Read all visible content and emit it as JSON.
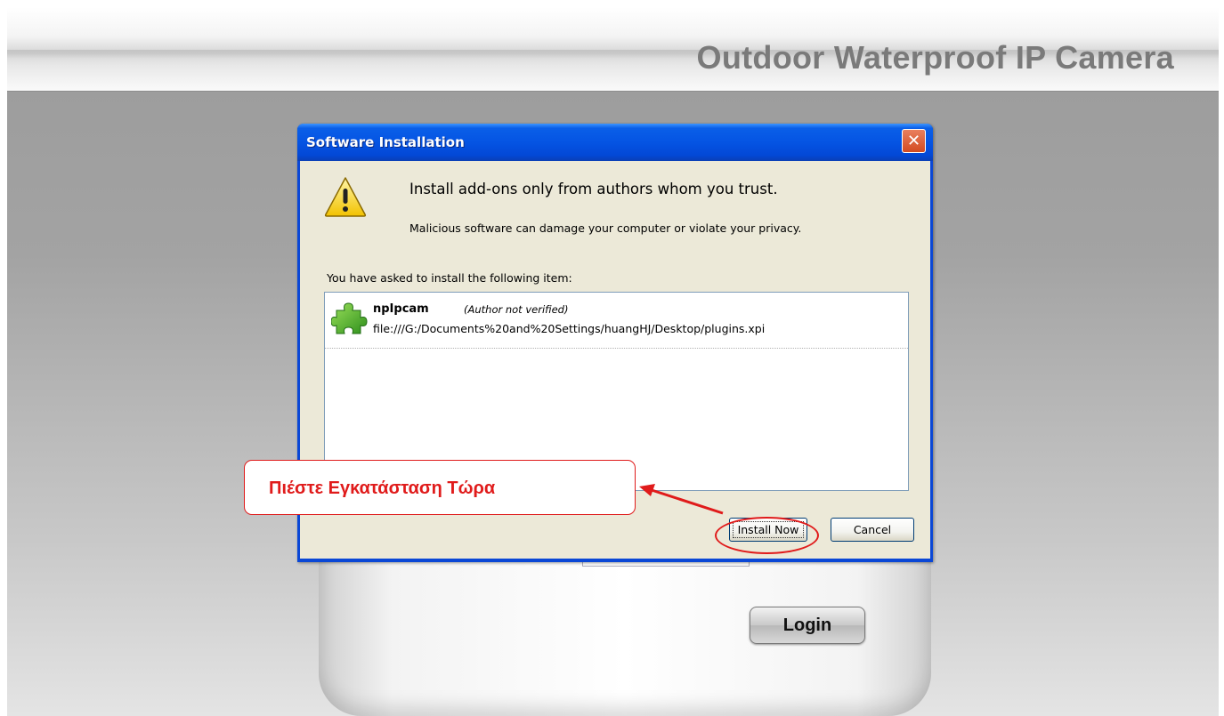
{
  "page": {
    "banner_title": "Outdoor Waterproof IP Camera",
    "login_button": "Login"
  },
  "dialog": {
    "title": "Software Installation",
    "close_glyph": "✕",
    "headline": "Install add-ons only from authors whom you trust.",
    "warning": "Malicious software can damage your computer or violate your privacy.",
    "asked_label": "You have asked to install the following item:",
    "items": [
      {
        "name": "npIpcam",
        "author": "(Author not verified)",
        "url": "file:///G:/Documents%20and%20Settings/huangHJ/Desktop/plugins.xpi",
        "icon": "puzzle-piece-icon"
      }
    ],
    "install_button": "Install Now",
    "cancel_button": "Cancel"
  },
  "annotation": {
    "callout_text": "Πιέστε Εγκατάσταση Τώρα",
    "color": "#e01b1b"
  },
  "colors": {
    "titlebar": "#0554e3",
    "dialog_body": "#ece9d8",
    "accent_red": "#e01b1b"
  }
}
